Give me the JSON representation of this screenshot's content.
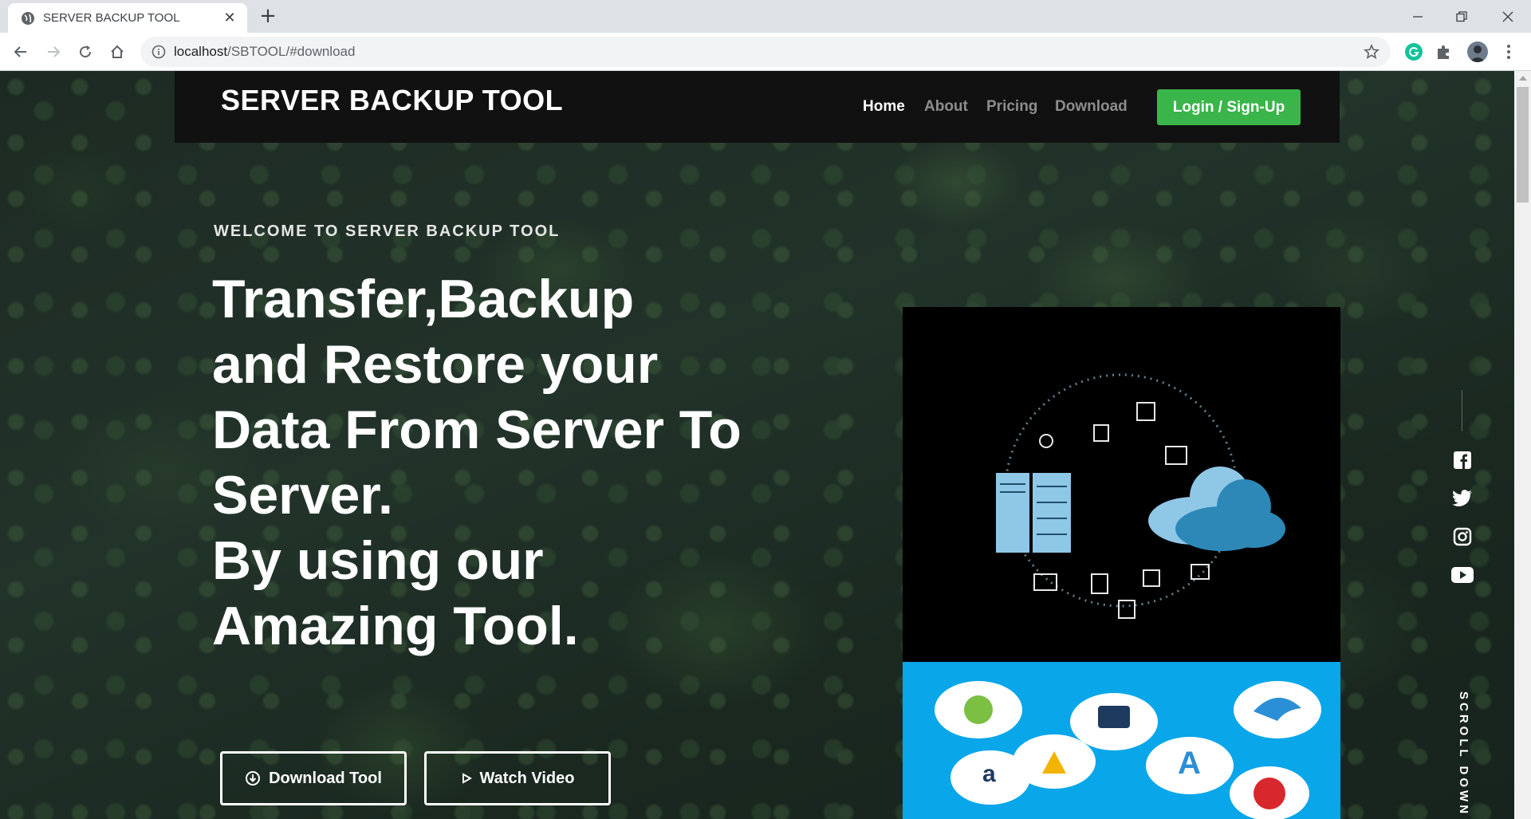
{
  "browser": {
    "tab_title": "SERVER BACKUP TOOL",
    "new_tab_symbol": "+",
    "close_symbol": "✕",
    "url_host": "localhost",
    "url_path": "/SBTOOL/#download"
  },
  "site": {
    "brand": "SERVER BACKUP TOOL",
    "menu": {
      "home": "Home",
      "about": "About",
      "pricing": "Pricing",
      "download": "Download"
    },
    "login_label": "Login / Sign-Up",
    "accent_color": "#3ab54a"
  },
  "hero": {
    "eyebrow": "WELCOME TO SERVER BACKUP TOOL",
    "headline_lines": [
      "Transfer,Backup",
      "and Restore your",
      "Data From Server To",
      "Server.",
      "By using our",
      "Amazing Tool."
    ],
    "download_label": "Download Tool",
    "video_label": "Watch Video"
  },
  "sidebar": {
    "social_icons": [
      "facebook-icon",
      "twitter-icon",
      "instagram-icon",
      "youtube-icon"
    ],
    "scroll_label": "SCROLL DOWN"
  }
}
